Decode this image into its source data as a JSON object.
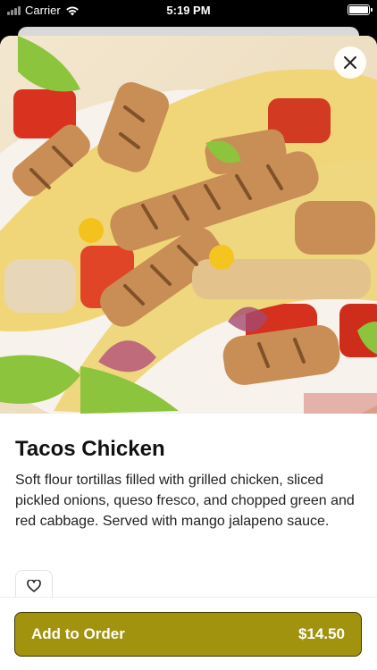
{
  "status_bar": {
    "carrier": "Carrier",
    "time": "5:19 PM"
  },
  "hero": {
    "image_alt": "Grilled chicken tacos with peppers and corn",
    "close_icon": "close-icon"
  },
  "item": {
    "title": "Tacos Chicken",
    "description": "Soft flour tortillas filled with grilled chicken, sliced pickled onions, queso fresco, and chopped green and red cabbage. Served with mango jalapeno sauce."
  },
  "favorite": {
    "icon": "heart-icon"
  },
  "order": {
    "label": "Add to Order",
    "price": "$14.50"
  },
  "colors": {
    "accent": "#a1930d",
    "accent_border": "#3d3706"
  }
}
